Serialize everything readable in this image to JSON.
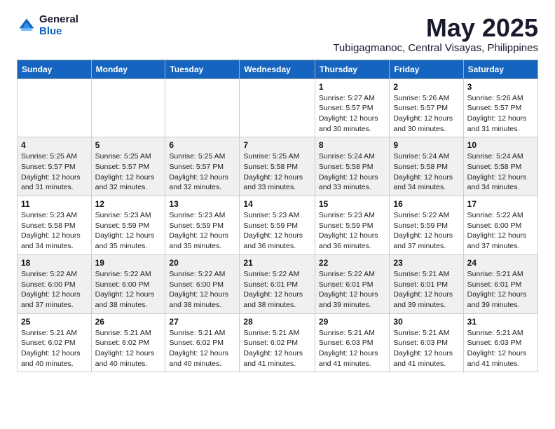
{
  "logo": {
    "general": "General",
    "blue": "Blue"
  },
  "title": "May 2025",
  "subtitle": "Tubigagmanoc, Central Visayas, Philippines",
  "days_of_week": [
    "Sunday",
    "Monday",
    "Tuesday",
    "Wednesday",
    "Thursday",
    "Friday",
    "Saturday"
  ],
  "weeks": [
    [
      {
        "day": "",
        "info": ""
      },
      {
        "day": "",
        "info": ""
      },
      {
        "day": "",
        "info": ""
      },
      {
        "day": "",
        "info": ""
      },
      {
        "day": "1",
        "info": "Sunrise: 5:27 AM\nSunset: 5:57 PM\nDaylight: 12 hours\nand 30 minutes."
      },
      {
        "day": "2",
        "info": "Sunrise: 5:26 AM\nSunset: 5:57 PM\nDaylight: 12 hours\nand 30 minutes."
      },
      {
        "day": "3",
        "info": "Sunrise: 5:26 AM\nSunset: 5:57 PM\nDaylight: 12 hours\nand 31 minutes."
      }
    ],
    [
      {
        "day": "4",
        "info": "Sunrise: 5:25 AM\nSunset: 5:57 PM\nDaylight: 12 hours\nand 31 minutes."
      },
      {
        "day": "5",
        "info": "Sunrise: 5:25 AM\nSunset: 5:57 PM\nDaylight: 12 hours\nand 32 minutes."
      },
      {
        "day": "6",
        "info": "Sunrise: 5:25 AM\nSunset: 5:57 PM\nDaylight: 12 hours\nand 32 minutes."
      },
      {
        "day": "7",
        "info": "Sunrise: 5:25 AM\nSunset: 5:58 PM\nDaylight: 12 hours\nand 33 minutes."
      },
      {
        "day": "8",
        "info": "Sunrise: 5:24 AM\nSunset: 5:58 PM\nDaylight: 12 hours\nand 33 minutes."
      },
      {
        "day": "9",
        "info": "Sunrise: 5:24 AM\nSunset: 5:58 PM\nDaylight: 12 hours\nand 34 minutes."
      },
      {
        "day": "10",
        "info": "Sunrise: 5:24 AM\nSunset: 5:58 PM\nDaylight: 12 hours\nand 34 minutes."
      }
    ],
    [
      {
        "day": "11",
        "info": "Sunrise: 5:23 AM\nSunset: 5:58 PM\nDaylight: 12 hours\nand 34 minutes."
      },
      {
        "day": "12",
        "info": "Sunrise: 5:23 AM\nSunset: 5:59 PM\nDaylight: 12 hours\nand 35 minutes."
      },
      {
        "day": "13",
        "info": "Sunrise: 5:23 AM\nSunset: 5:59 PM\nDaylight: 12 hours\nand 35 minutes."
      },
      {
        "day": "14",
        "info": "Sunrise: 5:23 AM\nSunset: 5:59 PM\nDaylight: 12 hours\nand 36 minutes."
      },
      {
        "day": "15",
        "info": "Sunrise: 5:23 AM\nSunset: 5:59 PM\nDaylight: 12 hours\nand 36 minutes."
      },
      {
        "day": "16",
        "info": "Sunrise: 5:22 AM\nSunset: 5:59 PM\nDaylight: 12 hours\nand 37 minutes."
      },
      {
        "day": "17",
        "info": "Sunrise: 5:22 AM\nSunset: 6:00 PM\nDaylight: 12 hours\nand 37 minutes."
      }
    ],
    [
      {
        "day": "18",
        "info": "Sunrise: 5:22 AM\nSunset: 6:00 PM\nDaylight: 12 hours\nand 37 minutes."
      },
      {
        "day": "19",
        "info": "Sunrise: 5:22 AM\nSunset: 6:00 PM\nDaylight: 12 hours\nand 38 minutes."
      },
      {
        "day": "20",
        "info": "Sunrise: 5:22 AM\nSunset: 6:00 PM\nDaylight: 12 hours\nand 38 minutes."
      },
      {
        "day": "21",
        "info": "Sunrise: 5:22 AM\nSunset: 6:01 PM\nDaylight: 12 hours\nand 38 minutes."
      },
      {
        "day": "22",
        "info": "Sunrise: 5:22 AM\nSunset: 6:01 PM\nDaylight: 12 hours\nand 39 minutes."
      },
      {
        "day": "23",
        "info": "Sunrise: 5:21 AM\nSunset: 6:01 PM\nDaylight: 12 hours\nand 39 minutes."
      },
      {
        "day": "24",
        "info": "Sunrise: 5:21 AM\nSunset: 6:01 PM\nDaylight: 12 hours\nand 39 minutes."
      }
    ],
    [
      {
        "day": "25",
        "info": "Sunrise: 5:21 AM\nSunset: 6:02 PM\nDaylight: 12 hours\nand 40 minutes."
      },
      {
        "day": "26",
        "info": "Sunrise: 5:21 AM\nSunset: 6:02 PM\nDaylight: 12 hours\nand 40 minutes."
      },
      {
        "day": "27",
        "info": "Sunrise: 5:21 AM\nSunset: 6:02 PM\nDaylight: 12 hours\nand 40 minutes."
      },
      {
        "day": "28",
        "info": "Sunrise: 5:21 AM\nSunset: 6:02 PM\nDaylight: 12 hours\nand 41 minutes."
      },
      {
        "day": "29",
        "info": "Sunrise: 5:21 AM\nSunset: 6:03 PM\nDaylight: 12 hours\nand 41 minutes."
      },
      {
        "day": "30",
        "info": "Sunrise: 5:21 AM\nSunset: 6:03 PM\nDaylight: 12 hours\nand 41 minutes."
      },
      {
        "day": "31",
        "info": "Sunrise: 5:21 AM\nSunset: 6:03 PM\nDaylight: 12 hours\nand 41 minutes."
      }
    ]
  ]
}
